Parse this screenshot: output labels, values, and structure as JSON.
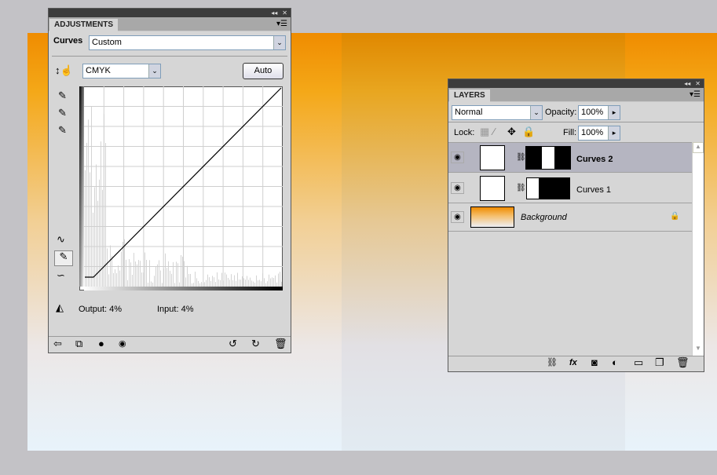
{
  "adjustments": {
    "tab": "ADJUSTMENTS",
    "preset_label": "Curves",
    "preset_value": "Custom",
    "channel": "CMYK",
    "auto_label": "Auto",
    "output": "Output: 4%",
    "input": "Input: 4%"
  },
  "layers": {
    "tab": "LAYERS",
    "blend_mode": "Normal",
    "opacity_label": "Opacity:",
    "opacity": "100%",
    "lock_label": "Lock:",
    "fill_label": "Fill:",
    "fill": "100%",
    "items": [
      {
        "name": "Curves 2",
        "selected": true
      },
      {
        "name": "Curves 1",
        "selected": false
      },
      {
        "name": "Background",
        "selected": false
      }
    ]
  },
  "colors": {
    "selected_row": "#b5b5c1",
    "panel": "#d6d6d6"
  }
}
